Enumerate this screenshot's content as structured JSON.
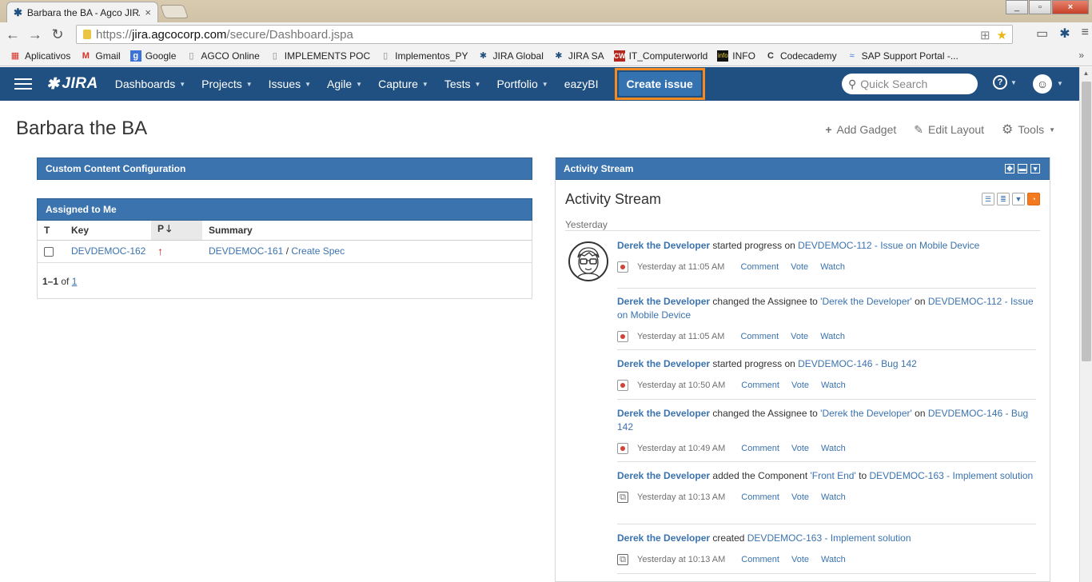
{
  "browser": {
    "tab_title": "Barbara the BA - Agco JIRA",
    "url_proto": "https://",
    "url_host": "jira.agcocorp.com",
    "url_path": "/secure/Dashboard.jspa"
  },
  "bookmarks": [
    {
      "label": "Aplicativos",
      "icon": "apps-grid-icon"
    },
    {
      "label": "Gmail",
      "icon": "gmail-icon"
    },
    {
      "label": "Google",
      "icon": "google-icon"
    },
    {
      "label": "AGCO Online",
      "icon": "page-icon"
    },
    {
      "label": "IMPLEMENTS POC",
      "icon": "page-icon"
    },
    {
      "label": "Implementos_PY",
      "icon": "page-icon"
    },
    {
      "label": "JIRA Global",
      "icon": "jira-icon"
    },
    {
      "label": "JIRA SA",
      "icon": "jira-icon"
    },
    {
      "label": "IT_Computerworld",
      "icon": "cw-icon"
    },
    {
      "label": "INFO",
      "icon": "info-icon"
    },
    {
      "label": "Codecademy",
      "icon": "codecademy-icon"
    },
    {
      "label": "SAP Support Portal -...",
      "icon": "sap-icon"
    }
  ],
  "header": {
    "logo": "JIRA",
    "nav": [
      "Dashboards",
      "Projects",
      "Issues",
      "Agile",
      "Capture",
      "Tests",
      "Portfolio",
      "eazyBI"
    ],
    "create_label": "Create issue",
    "search_placeholder": "Quick Search"
  },
  "page": {
    "title": "Barbara the BA",
    "actions": {
      "add_gadget": "Add Gadget",
      "edit_layout": "Edit Layout",
      "tools": "Tools"
    }
  },
  "gadgets": {
    "ccc_title": "Custom Content Configuration",
    "assigned": {
      "title": "Assigned to Me",
      "columns": {
        "t": "T",
        "key": "Key",
        "p": "P",
        "summary": "Summary"
      },
      "row": {
        "key": "DEVDEMOC-162",
        "parent": "DEVDEMOC-161",
        "sep": "/",
        "summary": "Create Spec"
      },
      "pagination": {
        "range": "1–1",
        "of": "of",
        "total": "1"
      }
    },
    "activity": {
      "head": "Activity Stream",
      "title": "Activity Stream",
      "day": "Yesterday",
      "actions": {
        "comment": "Comment",
        "vote": "Vote",
        "watch": "Watch"
      },
      "entries": [
        {
          "user": "Derek the Developer",
          "text1": " started progress on ",
          "link1": "DEVDEMOC-112 - Issue on Mobile Device",
          "time": "Yesterday at 11:05 AM",
          "type": "bug"
        },
        {
          "user": "Derek the Developer",
          "text1": " changed the Assignee to ",
          "link1": "'Derek the Developer'",
          "text2": " on ",
          "link2": "DEVDEMOC-112 - Issue on Mobile Device",
          "time": "Yesterday at 11:05 AM",
          "type": "bug"
        },
        {
          "user": "Derek the Developer",
          "text1": " started progress on ",
          "link1": "DEVDEMOC-146 - Bug 142",
          "time": "Yesterday at 10:50 AM",
          "type": "bug"
        },
        {
          "user": "Derek the Developer",
          "text1": " changed the Assignee to ",
          "link1": "'Derek the Developer'",
          "text2": " on ",
          "link2": "DEVDEMOC-146 - Bug 142",
          "time": "Yesterday at 10:49 AM",
          "type": "bug"
        },
        {
          "user": "Derek the Developer",
          "text1": " added the Component ",
          "link1": "'Front End'",
          "text2": " to ",
          "link2": "DEVDEMOC-163 - Implement solution",
          "time": "Yesterday at 10:13 AM",
          "type": "story"
        },
        {
          "user": "Derek the Developer",
          "text1": " created ",
          "link1": "DEVDEMOC-163 - Implement solution",
          "time": "Yesterday at 10:13 AM",
          "type": "story"
        }
      ]
    }
  },
  "colors": {
    "header": "#205081",
    "gadget_head": "#3b73af",
    "link": "#3b73af",
    "highlight": "#f68b1f"
  }
}
